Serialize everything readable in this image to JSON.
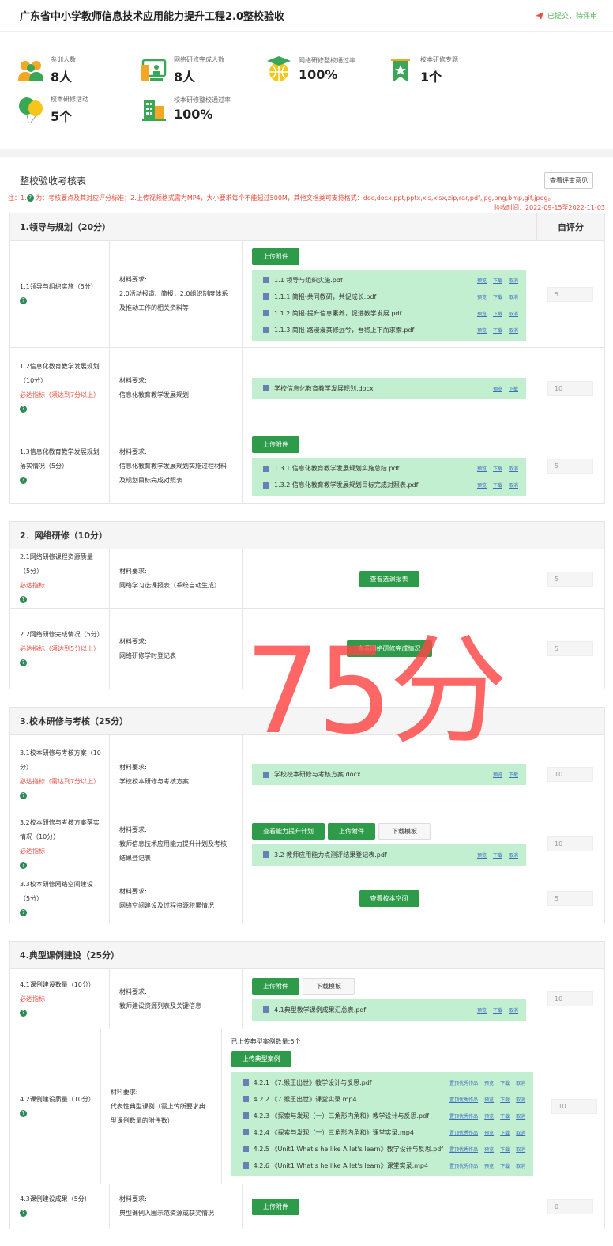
{
  "header": {
    "title": "广东省中小学教师信息技术应用能力提升工程2.0整校验收",
    "status": "已提交，待评审"
  },
  "stats": [
    {
      "label": "参训人数",
      "value": "8人",
      "icon": "people-icon"
    },
    {
      "label": "网络研修完成人数",
      "value": "8人",
      "icon": "computer-training-icon"
    },
    {
      "label": "网络研修整校通过率",
      "value": "100%",
      "icon": "graduation-globe-icon"
    },
    {
      "label": "校本研修专题",
      "value": "1个",
      "icon": "ribbon-star-icon"
    },
    {
      "label": "校本研修活动",
      "value": "5个",
      "icon": "balloons-icon"
    },
    {
      "label": "校本研修整校通过率",
      "value": "100%",
      "icon": "building-icon"
    }
  ],
  "assessment": {
    "title": "整校验收考核表",
    "view_opinion": "查看评审意见"
  },
  "notes": {
    "prefix": "注：1.",
    "text": "为：考核要点及其对应评分标准；2.上传视频格式需为MP4，大小要求每个不能超过500M，其他文档类可支持格式：doc,docx,ppt,pptx,xls,xlsx,zip,rar,pdf,jpg,png,bmp,gif,jpeg。",
    "time": "验收时间：2022-09-15至2022-11-03"
  },
  "self_score_label": "自评分",
  "sections": [
    {
      "title": "1.领导与规划（20分）",
      "rows": [
        {
          "item": "1.1领导与组织实施（5分）",
          "req": "",
          "mat_title": "材料要求:",
          "mat": "2.0活动报道、简报，2.0组织制度体系及推动工作的相关资料等",
          "buttons": [
            "上传附件"
          ],
          "files": [
            {
              "name": "1.1 领导与组织实施.pdf",
              "actions": [
                "预览",
                "下载",
                "取消"
              ]
            },
            {
              "name": "1.1.1 简报-共同教研，共促成长.pdf",
              "actions": [
                "预览",
                "下载",
                "取消"
              ]
            },
            {
              "name": "1.1.2 简报-提升信息素养，促进教学发展.pdf",
              "actions": [
                "预览",
                "下载",
                "取消"
              ]
            },
            {
              "name": "1.1.3 简报-路漫漫其修远兮，吾将上下而求索.pdf",
              "actions": [
                "预览",
                "下载",
                "取消"
              ]
            }
          ],
          "score": "5"
        },
        {
          "item": "1.2信息化教育教学发展规划（10分）",
          "req": "必达指标（须达到7分以上）",
          "mat_title": "材料要求:",
          "mat": "信息化教育教学发展规划",
          "buttons": [],
          "files": [
            {
              "name": "学校信息化教育教学发展规划.docx",
              "actions": [
                "预览",
                "下载"
              ]
            }
          ],
          "score": "10"
        },
        {
          "item": "1.3信息化教育教学发展规划落实情况（5分）",
          "req": "",
          "mat_title": "材料要求:",
          "mat": "信息化教育教学发展规划实施过程材料及规划目标完成对照表",
          "buttons": [
            "上传附件"
          ],
          "files": [
            {
              "name": "1.3.1 信息化教育教学发展规划实施总结.pdf",
              "actions": [
                "预览",
                "下载",
                "取消"
              ]
            },
            {
              "name": "1.3.2 信息化教育教学发展规划目标完成对照表.pdf",
              "actions": [
                "预览",
                "下载",
                "取消"
              ]
            }
          ],
          "score": "5"
        }
      ]
    },
    {
      "title": "2．网络研修（10分）",
      "rows": [
        {
          "item": "2.1网络研修课程资源质量（5分）",
          "req": "必达指标",
          "mat_title": "材料要求:",
          "mat": "网络学习选课报表（系统自动生成）",
          "center_button": "查看选课报表",
          "score": "5"
        },
        {
          "item": "2.2网络研修完成情况（5分）",
          "req": "必达指标（须达到5分以上）",
          "mat_title": "材料要求:",
          "mat": "网络研修学时登记表",
          "center_button": "查看网络研修完成情况",
          "score": "5"
        }
      ]
    },
    {
      "title": "3.校本研修与考核（25分）",
      "rows": [
        {
          "item": "3.1校本研修与考核方案（10分）",
          "req": "必达指标（需达到7分以上）",
          "mat_title": "材料要求:",
          "mat": "学校校本研修与考核方案",
          "buttons": [],
          "files": [
            {
              "name": "学校校本研修与考核方案.docx",
              "actions": [
                "预览",
                "下载"
              ]
            }
          ],
          "score": "10"
        },
        {
          "item": "3.2校本研修与考核方案落实情况（10分）",
          "req": "必达指标",
          "mat_title": "材料要求:",
          "mat": "教师信息技术应用能力提升计划及考核结果登记表",
          "buttons": [
            "查看能力提升计划",
            "上传附件",
            "下载模板"
          ],
          "files": [
            {
              "name": "3.2 教师应用能力点测评结果登记表.pdf",
              "actions": [
                "预览",
                "下载",
                "取消"
              ]
            }
          ],
          "score": "10"
        },
        {
          "item": "3.3校本研修网络空间建设（5分）",
          "req": "",
          "mat_title": "材料要求:",
          "mat": "网络空间建设及过程资源积累情况",
          "center_button": "查看校本空间",
          "score": "5"
        }
      ]
    },
    {
      "title": "4.典型课例建设（25分）",
      "rows": [
        {
          "item": "4.1课例建设数量（10分）",
          "req": "必达指标",
          "mat_title": "材料要求:",
          "mat": "教师建设资源列表及关键信息",
          "buttons": [
            "上传附件",
            "下载模板"
          ],
          "files": [
            {
              "name": "4.1典型教学课例成果汇总表.pdf",
              "actions": [
                "预览",
                "下载",
                "取消"
              ]
            }
          ],
          "score": "10"
        },
        {
          "item": "4.2课例建设质量（10分）",
          "req": "",
          "mat_title": "材料要求:",
          "mat": "代表性典型课例（需上传所要求典型课例数量的附件数）",
          "uploaded": "已上传典型案例数量:6个",
          "buttons": [
            "上传典型案例"
          ],
          "files": [
            {
              "name": "4.2.1 《7.猴王出世》教学设计与反思.pdf",
              "actions": [
                "置顶优秀作品",
                "预览",
                "下载",
                "取消"
              ]
            },
            {
              "name": "4.2.2 《7.猴王出世》课堂实录.mp4",
              "actions": [
                "置顶优秀作品",
                "预览",
                "下载",
                "取消"
              ]
            },
            {
              "name": "4.2.3 《探索与发现（一）三角形内角和》教学设计与反思.pdf",
              "actions": [
                "置顶优秀作品",
                "预览",
                "下载",
                "取消"
              ]
            },
            {
              "name": "4.2.4 《探索与发现（一）三角形内角和》课堂实录.mp4",
              "actions": [
                "置顶优秀作品",
                "预览",
                "下载",
                "取消"
              ]
            },
            {
              "name": "4.2.5 《Unit1 What's he like A let's learn》教学设计与反思.pdf",
              "actions": [
                "置顶优秀作品",
                "预览",
                "下载",
                "取消"
              ]
            },
            {
              "name": "4.2.6 《Unit1 What's he like A let's learn》课堂实录.mp4",
              "actions": [
                "置顶优秀作品",
                "预览",
                "下载",
                "取消"
              ]
            }
          ],
          "score": "10"
        },
        {
          "item": "4.3课例建设成果（5分）",
          "req": "",
          "mat_title": "材料要求:",
          "mat": "典型课例入围示范资源或获奖情况",
          "buttons": [
            "上传附件"
          ],
          "files": [],
          "score": "0"
        }
      ]
    }
  ],
  "watermark": "75分",
  "colors": {
    "green": "#2e9b4b",
    "file_bg": "#c2efd0",
    "red": "#e74c3c",
    "link": "#3b6dc0"
  }
}
